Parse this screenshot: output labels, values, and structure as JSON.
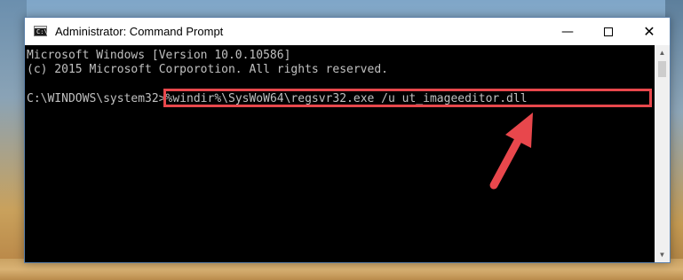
{
  "window": {
    "title": "Administrator: Command Prompt",
    "app_icon_glyph": "C:\\_",
    "controls": {
      "minimize": "—",
      "maximize": "",
      "close": "✕"
    }
  },
  "console": {
    "lines": [
      "Microsoft Windows [Version 10.0.10586]",
      "(c) 2015 Microsoft Corporotion. All rights reserved."
    ],
    "prompt": "C:\\WINDOWS\\system32>",
    "command": "%windir%\\SysWoW64\\regsvr32.exe /u ut_imageeditor.dll"
  },
  "scrollbar": {
    "up_glyph": "▲",
    "down_glyph": "▼"
  },
  "annotation": {
    "highlight_color": "#e8474c",
    "arrow_color": "#e8474c",
    "arrow_icon": "red-pointer-arrow-icon"
  }
}
